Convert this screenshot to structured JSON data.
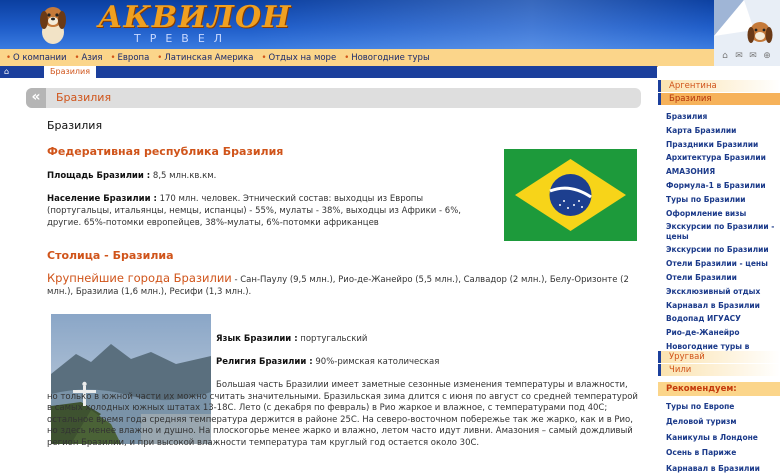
{
  "header": {
    "logo_text": "АКВИЛОН",
    "logo_subtitle": "ТРЕВЕЛ",
    "corner_icons": [
      "home-icon",
      "mail-icon",
      "email-icon",
      "sitemap-icon"
    ]
  },
  "nav": {
    "items": [
      "О компании",
      "Азия",
      "Европа",
      "Латинская Америка",
      "Отдых на море",
      "Новогодние туры"
    ]
  },
  "breadcrumb": {
    "current": "Бразилия"
  },
  "page": {
    "title_bar": "Бразилия",
    "heading": "Бразилия",
    "section1": "Федеративная республика Бразилия",
    "area_label": "Площадь Бразилии :",
    "area_value": "8,5 млн.кв.км.",
    "population_label": "Население Бразилии :",
    "population_value": "170 млн. человек. Этнический состав: выходцы из Европы (португальцы, итальянцы, немцы, испанцы) - 55%, мулаты - 38%, выходцы из Африки - 6%, другие. 65%-потомки европейцев, 38%-мулаты, 6%-потомки африканцев",
    "capital": "Столица - Бразилиа",
    "cities_label": "Крупнейшие города Бразилии",
    "cities_value": " - Сан-Паулу (9,5 млн.), Рио-де-Жанейро (5,5 млн.), Салвадор (2 млн.), Белу-Оризонте (2 млн.), Бразилиа (1,6 млн.), Ресифи (1,3 млн.).",
    "language_label": "Язык Бразилии :",
    "language_value": "португальский",
    "religion_label": "Религия Бразилии :",
    "religion_value": "90%-римская католическая",
    "climate_text": "Большая часть Бразилии имеет заметные сезонные изменения температуры и влажности, но только в южной части их можно считать значительными. Бразильская зима длится с июня по август со средней температурой в самых холодных южных штатах 13-18С. Лето (с декабря по февраль) в Рио жаркое и влажное, с температурами под 40С; остальное время года средняя температура держится в районе 25С. На северо-восточном побережье так же жарко, как и в Рио, но здесь менее влажно и душно. На плоскогорье менее жарко и влажно, летом часто идут ливни. Амазония – самый дождливый регион Бразилии, и при высокой влажности температура там круглый год остается около 30С."
  },
  "sidebar": {
    "countries_top": [
      "Аргентина",
      "Бразилия"
    ],
    "brazil_links": [
      "Бразилия",
      "Карта Бразилии",
      "Праздники Бразилии",
      "Архитектура Бразилии",
      "АМАЗОНИЯ",
      "Формула-1 в Бразилии",
      "Туры по Бразилии",
      "Оформление визы",
      "Экскурсии по Бразилии - цены",
      "Экскурсии по Бразилии",
      "Отели Бразилии - цены",
      "Отели Бразилии",
      "Эксклюзивный отдых",
      "Карнавал в Бразилии",
      "Водопад ИГУАСУ",
      "Рио-де-Жанейро",
      "Новогодние туры в Бразилию"
    ],
    "countries_bottom": [
      "Уругвай",
      "Чили"
    ],
    "recommend_title": "Рекомендуем:",
    "recommend_links": [
      "Туры по Европе",
      "Деловой туризм",
      "Каникулы в Лондоне",
      "Осень в Париже",
      "Карнавал в Бразилии"
    ]
  },
  "colors": {
    "nav_bg": "#fbd58a",
    "accent_orange": "#d0541a",
    "link_blue": "#1b3a8a",
    "header_blue": "#1b3f9c"
  }
}
